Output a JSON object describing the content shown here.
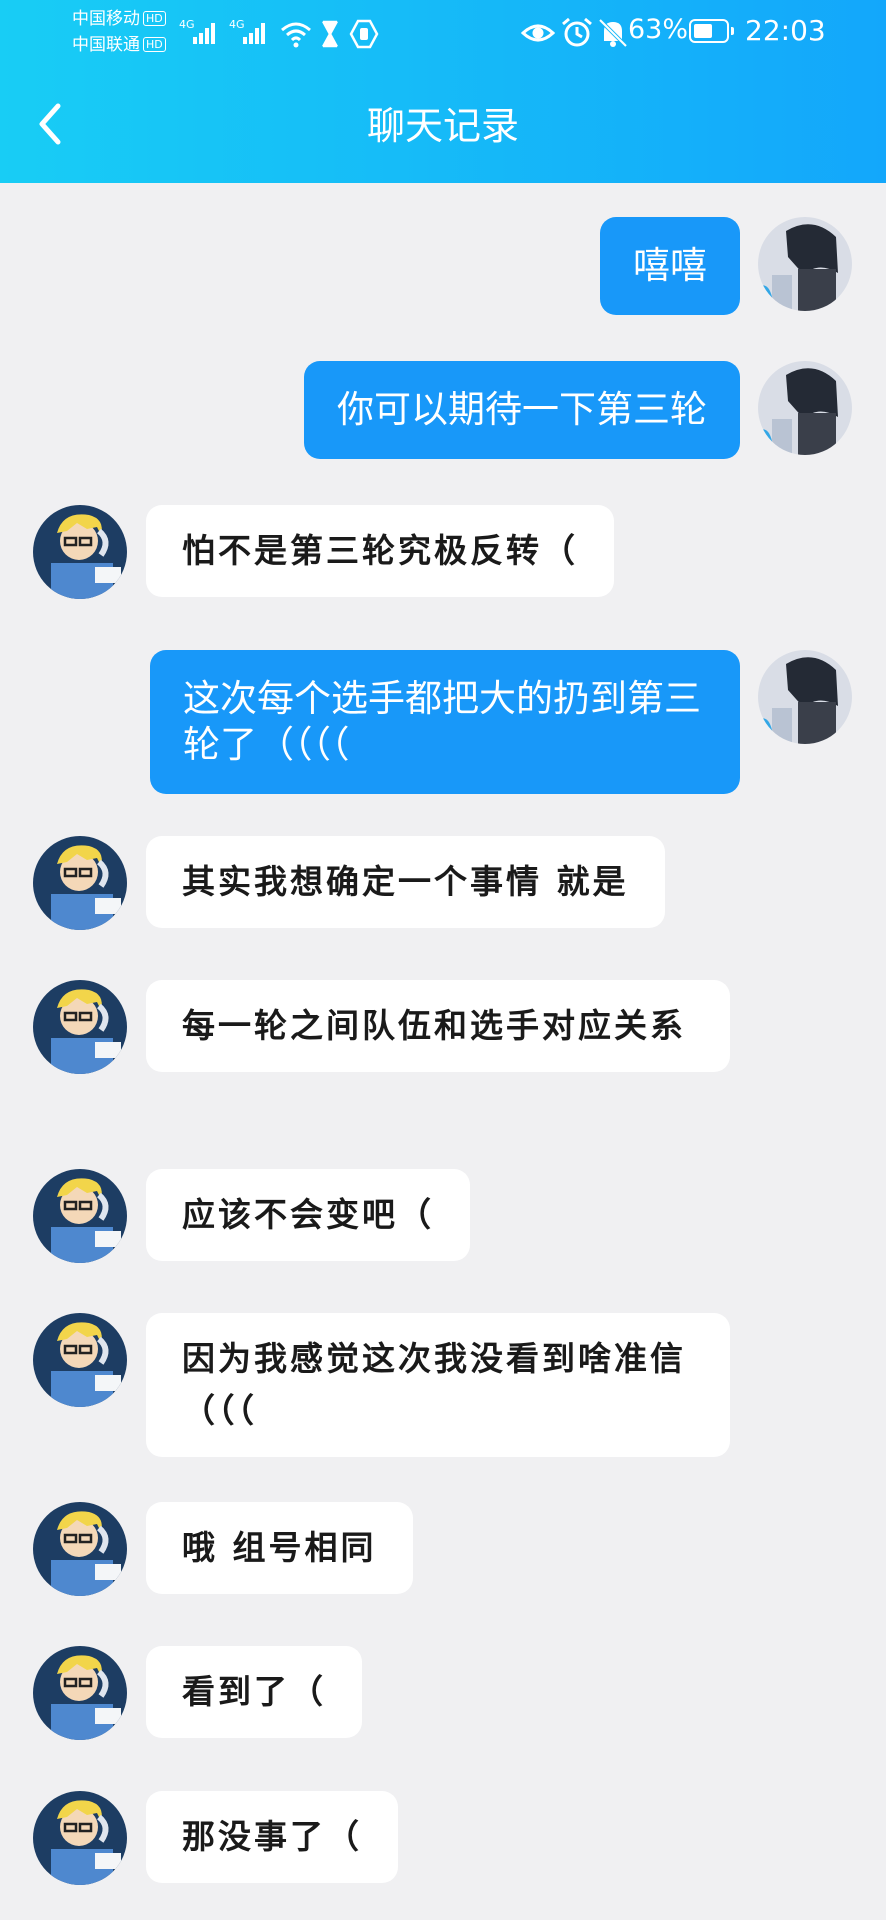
{
  "status_bar": {
    "carrier1": "中国移动",
    "carrier2": "中国联通",
    "hd_badge": "HD",
    "network1": "4G",
    "network2": "4G",
    "icons": [
      "wifi-icon",
      "hourglass-icon",
      "hand-icon",
      "eye-icon",
      "alarm-icon",
      "mute-bell-icon"
    ],
    "battery_percent": "63%",
    "battery_level": 0.63,
    "time": "22:03"
  },
  "header": {
    "title": "聊天记录",
    "back_icon": "chevron-left-icon",
    "gradient": [
      "#18cdf5",
      "#13a7fb"
    ]
  },
  "colors": {
    "my_bubble": "#1898f9",
    "other_bubble": "#ffffff",
    "background": "#f0f0f2"
  },
  "messages": [
    {
      "side": "me",
      "text": "嘻嘻"
    },
    {
      "side": "me",
      "text": "你可以期待一下第三轮"
    },
    {
      "side": "other",
      "text": "怕不是第三轮究极反转（"
    },
    {
      "side": "me",
      "text": "这次每个选手都把大的扔到第三轮了（（（（"
    },
    {
      "side": "other",
      "text": "其实我想确定一个事情 就是"
    },
    {
      "side": "other",
      "text": "每一轮之间队伍和选手对应关系"
    },
    {
      "side": "other",
      "text": "应该不会变吧（"
    },
    {
      "side": "other",
      "text": "因为我感觉这次我没看到啥准信（（（"
    },
    {
      "side": "other",
      "text": "哦 组号相同"
    },
    {
      "side": "other",
      "text": "看到了（"
    },
    {
      "side": "other",
      "text": "那没事了（"
    }
  ]
}
